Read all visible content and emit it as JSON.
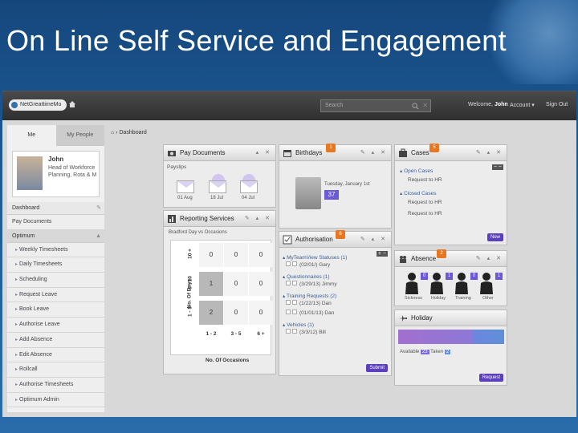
{
  "slide_title": "On Line Self Service and Engagement",
  "topbar": {
    "logo_text": "NetGreattimeMo",
    "search_placeholder": "Search",
    "welcome_prefix": "Welcome,",
    "welcome_name": "John",
    "account_label": "Account",
    "signout_label": "Sign Out"
  },
  "leftnav": {
    "tabs": [
      "Me",
      "My People"
    ],
    "profile": {
      "name": "John",
      "job": "Head of Workforce Planning, Rota & M"
    },
    "dashboard_label": "Dashboard",
    "pay_documents_label": "Pay Documents",
    "optimum_label": "Optimum",
    "items": [
      "Weekly Timesheets",
      "Daily Timesheets",
      "Scheduling",
      "Request Leave",
      "Book Leave",
      "Authorise Leave",
      "Add Absence",
      "Edit Absence",
      "Rollcall",
      "Authorise Timesheets",
      "Optimum Admin"
    ]
  },
  "breadcrumb": "Dashboard",
  "pay_documents": {
    "title": "Pay Documents",
    "payslips_label": "Payslips",
    "dates": [
      "01 Aug",
      "18 Jul",
      "04 Jul"
    ]
  },
  "reporting": {
    "title": "Reporting Services",
    "subtitle": "Bradford Day vs Occasions",
    "y_label": "No. Of Days",
    "x_label": "No. Of Occasions",
    "rows": [
      "10 +",
      "6 - 10",
      "1 - 5"
    ],
    "cols": [
      "1 - 2",
      "3 - 5",
      "6 +"
    ],
    "values": [
      [
        "0",
        "0",
        "0"
      ],
      [
        "1",
        "0",
        "0"
      ],
      [
        "2",
        "0",
        "0"
      ]
    ]
  },
  "birthdays": {
    "title": "Birthdays",
    "badge": "1",
    "date_text": "Tuesday, January 1st",
    "age": "37"
  },
  "authorisation": {
    "title": "Authorisation",
    "badge": "6",
    "groups": [
      {
        "title": "MyTeamView Statuses (1)",
        "items": [
          "(02/01/) Gary"
        ]
      },
      {
        "title": "Questionnaires (1)",
        "items": [
          "(3/29/13) Jimmy"
        ]
      },
      {
        "title": "Training Requests (2)",
        "items": [
          "(1/22/13) Dan",
          "(01/01/13) Dan"
        ]
      },
      {
        "title": "Vehicles (1)",
        "items": [
          "(3/3/12) Bill"
        ]
      }
    ],
    "submit_label": "Submit"
  },
  "cases": {
    "title": "Cases",
    "badge": "5",
    "open_label": "Open Cases",
    "open_item": "Request to HR",
    "closed_label": "Closed Cases",
    "closed_items": [
      "Request to HR",
      "Request to HR"
    ],
    "new_label": "New"
  },
  "absence": {
    "title": "Absence",
    "badge": "2",
    "people": [
      {
        "label": "Sickness",
        "count": "0"
      },
      {
        "label": "Holiday",
        "count": "1"
      },
      {
        "label": "Training",
        "count": "0"
      },
      {
        "label": "Other",
        "count": "1"
      }
    ]
  },
  "holiday": {
    "title": "Holiday",
    "available_label": "Available",
    "available_value": "23",
    "taken_label": "Taken",
    "taken_value": "2",
    "request_label": "Request"
  }
}
